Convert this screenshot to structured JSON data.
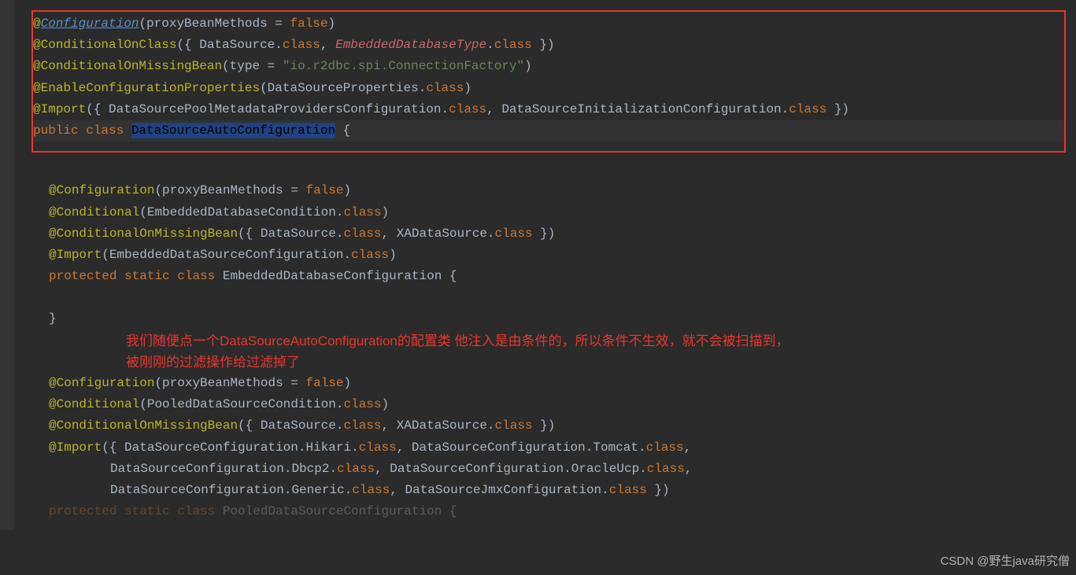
{
  "block1": {
    "line1": {
      "at": "@",
      "anno": "Configuration",
      "open": "(",
      "param": "proxyBeanMethods = ",
      "val": "false",
      "close": ")"
    },
    "line2": {
      "at": "@",
      "anno": "ConditionalOnClass",
      "open": "({ ",
      "c1": "DataSource",
      "dot1": ".",
      "kw1": "class",
      "comma": ", ",
      "c2": "EmbeddedDatabaseType",
      "dot2": ".",
      "kw2": "class",
      "close": " })"
    },
    "line3": {
      "at": "@",
      "anno": "ConditionalOnMissingBean",
      "open": "(",
      "param": "type = ",
      "str": "\"io.r2dbc.spi.ConnectionFactory\"",
      "close": ")"
    },
    "line4": {
      "at": "@",
      "anno": "EnableConfigurationProperties",
      "open": "(",
      "c1": "DataSourceProperties",
      "dot": ".",
      "kw": "class",
      "close": ")"
    },
    "line5": {
      "at": "@",
      "anno": "Import",
      "open": "({ ",
      "c1": "DataSourcePoolMetadataProvidersConfiguration",
      "dot1": ".",
      "kw1": "class",
      "comma": ", ",
      "c2": "DataSourceInitializationConfiguration",
      "dot2": ".",
      "kw2": "class",
      "close": " })"
    },
    "line6": {
      "kw1": "public ",
      "kw2": "class ",
      "name": "DataSourceAutoConfiguration",
      "brace": " {"
    }
  },
  "block2": {
    "line1": {
      "at": "@",
      "anno": "Configuration",
      "open": "(",
      "param": "proxyBeanMethods = ",
      "val": "false",
      "close": ")"
    },
    "line2": {
      "at": "@",
      "anno": "Conditional",
      "open": "(",
      "c1": "EmbeddedDatabaseCondition",
      "dot": ".",
      "kw": "class",
      "close": ")"
    },
    "line3": {
      "at": "@",
      "anno": "ConditionalOnMissingBean",
      "open": "({ ",
      "c1": "DataSource",
      "dot1": ".",
      "kw1": "class",
      "comma": ", ",
      "c2": "XADataSource",
      "dot2": ".",
      "kw2": "class",
      "close": " })"
    },
    "line4": {
      "at": "@",
      "anno": "Import",
      "open": "(",
      "c1": "EmbeddedDataSourceConfiguration",
      "dot": ".",
      "kw": "class",
      "close": ")"
    },
    "line5": {
      "kw1": "protected ",
      "kw2": "static ",
      "kw3": "class ",
      "name": "EmbeddedDatabaseConfiguration ",
      "brace": "{"
    },
    "line6": {
      "brace": "}"
    }
  },
  "annotation": {
    "text1": "我们随便点一个DataSourceAutoConfiguration的配置类 他注入是由条件的，所以条件不生效，就不会被扫描到，",
    "text2": "被刚刚的过滤操作给过滤掉了"
  },
  "block3": {
    "line1": {
      "at": "@",
      "anno": "Configuration",
      "open": "(",
      "param": "proxyBeanMethods = ",
      "val": "false",
      "close": ")"
    },
    "line2": {
      "at": "@",
      "anno": "Conditional",
      "open": "(",
      "c1": "PooledDataSourceCondition",
      "dot": ".",
      "kw": "class",
      "close": ")"
    },
    "line3": {
      "at": "@",
      "anno": "ConditionalOnMissingBean",
      "open": "({ ",
      "c1": "DataSource",
      "dot1": ".",
      "kw1": "class",
      "comma": ", ",
      "c2": "XADataSource",
      "dot2": ".",
      "kw2": "class",
      "close": " })"
    },
    "line4": {
      "at": "@",
      "anno": "Import",
      "open": "({ ",
      "c1": "DataSourceConfiguration",
      "dot1": ".",
      "inner1": "Hikari",
      "dot1b": ".",
      "kw1": "class",
      "comma1": ", ",
      "c2": "DataSourceConfiguration",
      "dot2": ".",
      "inner2": "Tomcat",
      "dot2b": ".",
      "kw2": "class",
      "comma2": ","
    },
    "line5": {
      "c1": "DataSourceConfiguration",
      "dot1": ".",
      "inner1": "Dbcp2",
      "dot1b": ".",
      "kw1": "class",
      "comma1": ", ",
      "c2": "DataSourceConfiguration",
      "dot2": ".",
      "inner2": "OracleUcp",
      "dot2b": ".",
      "kw2": "class",
      "comma2": ","
    },
    "line6": {
      "c1": "DataSourceConfiguration",
      "dot1": ".",
      "inner1": "Generic",
      "dot1b": ".",
      "kw1": "class",
      "comma1": ", ",
      "c2": "DataSourceJmxConfiguration",
      "dot2": ".",
      "kw2": "class",
      "close": " })"
    },
    "line7": {
      "kw1": "protected ",
      "kw2": "static ",
      "kw3": "class ",
      "name": "PooledDataSourceConfiguration ",
      "brace": "{"
    }
  },
  "watermark": "CSDN @野生java研究僧"
}
